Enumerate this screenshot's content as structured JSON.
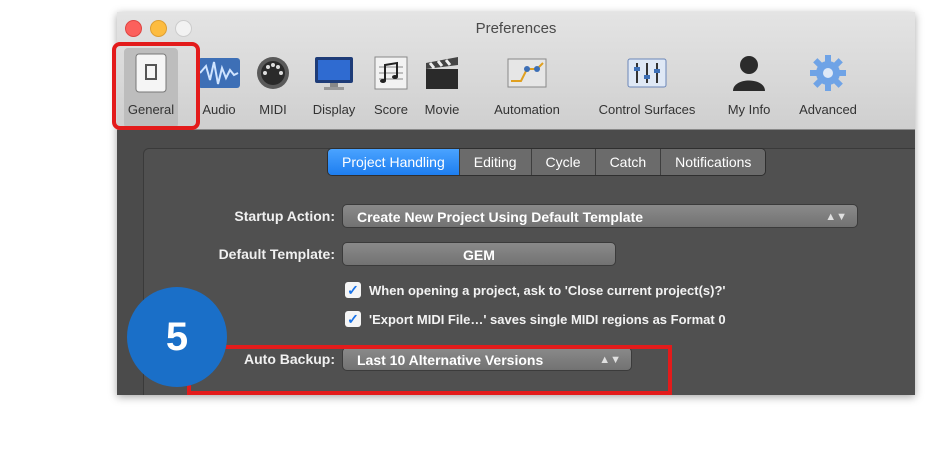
{
  "window": {
    "title": "Preferences"
  },
  "toolbar": {
    "items": [
      {
        "label": "General",
        "icon": "general-icon",
        "selected": true
      },
      {
        "label": "Audio",
        "icon": "audio-icon"
      },
      {
        "label": "MIDI",
        "icon": "midi-icon"
      },
      {
        "label": "Display",
        "icon": "display-icon"
      },
      {
        "label": "Score",
        "icon": "score-icon"
      },
      {
        "label": "Movie",
        "icon": "movie-icon"
      },
      {
        "label": "Automation",
        "icon": "automation-icon"
      },
      {
        "label": "Control Surfaces",
        "icon": "control-surfaces-icon"
      },
      {
        "label": "My Info",
        "icon": "my-info-icon"
      },
      {
        "label": "Advanced",
        "icon": "advanced-icon"
      }
    ]
  },
  "tabs": [
    {
      "label": "Project Handling",
      "active": true
    },
    {
      "label": "Editing"
    },
    {
      "label": "Cycle"
    },
    {
      "label": "Catch"
    },
    {
      "label": "Notifications"
    }
  ],
  "settings": {
    "startup_action": {
      "label": "Startup Action:",
      "value": "Create New Project Using Default Template"
    },
    "default_template": {
      "label": "Default Template:",
      "value": "GEM"
    },
    "check_close": {
      "checked": true,
      "label": "When opening a project, ask to 'Close current project(s)?'"
    },
    "check_export": {
      "checked": true,
      "label": "'Export MIDI File…' saves single MIDI regions as Format 0"
    },
    "auto_backup": {
      "label": "Auto Backup:",
      "value": "Last 10 Alternative Versions"
    }
  },
  "step_badge": "5",
  "colors": {
    "highlight": "#e31b1b",
    "badge": "#1a6fc8",
    "active_tab": "#1e7ef0"
  }
}
